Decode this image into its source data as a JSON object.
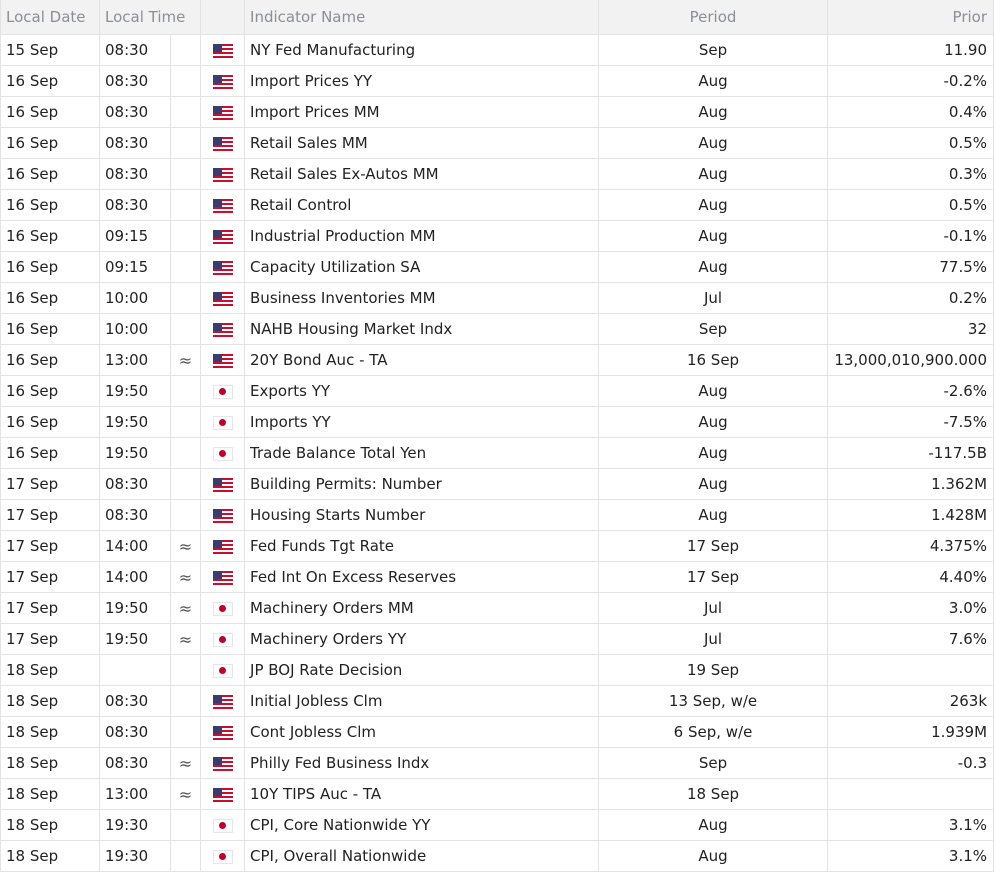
{
  "headers": {
    "date": "Local Date",
    "time": "Local Time",
    "indicator": "Indicator Name",
    "period": "Period",
    "prior": "Prior"
  },
  "flag_icons": {
    "us": "us-flag-icon",
    "jp": "japan-flag-icon"
  },
  "mark_glyph": "≈",
  "rows": [
    {
      "date": "15 Sep",
      "time": "08:30",
      "mark": "",
      "flag": "us",
      "name": "NY Fed Manufacturing",
      "period": "Sep",
      "prior": "11.90"
    },
    {
      "date": "16 Sep",
      "time": "08:30",
      "mark": "",
      "flag": "us",
      "name": "Import Prices YY",
      "period": "Aug",
      "prior": "-0.2%"
    },
    {
      "date": "16 Sep",
      "time": "08:30",
      "mark": "",
      "flag": "us",
      "name": "Import Prices MM",
      "period": "Aug",
      "prior": "0.4%"
    },
    {
      "date": "16 Sep",
      "time": "08:30",
      "mark": "",
      "flag": "us",
      "name": "Retail Sales MM",
      "period": "Aug",
      "prior": "0.5%"
    },
    {
      "date": "16 Sep",
      "time": "08:30",
      "mark": "",
      "flag": "us",
      "name": "Retail Sales Ex-Autos MM",
      "period": "Aug",
      "prior": "0.3%"
    },
    {
      "date": "16 Sep",
      "time": "08:30",
      "mark": "",
      "flag": "us",
      "name": "Retail Control",
      "period": "Aug",
      "prior": "0.5%"
    },
    {
      "date": "16 Sep",
      "time": "09:15",
      "mark": "",
      "flag": "us",
      "name": "Industrial Production MM",
      "period": "Aug",
      "prior": "-0.1%"
    },
    {
      "date": "16 Sep",
      "time": "09:15",
      "mark": "",
      "flag": "us",
      "name": "Capacity Utilization SA",
      "period": "Aug",
      "prior": "77.5%"
    },
    {
      "date": "16 Sep",
      "time": "10:00",
      "mark": "",
      "flag": "us",
      "name": "Business Inventories MM",
      "period": "Jul",
      "prior": "0.2%"
    },
    {
      "date": "16 Sep",
      "time": "10:00",
      "mark": "",
      "flag": "us",
      "name": "NAHB Housing Market Indx",
      "period": "Sep",
      "prior": "32"
    },
    {
      "date": "16 Sep",
      "time": "13:00",
      "mark": "≈",
      "flag": "us",
      "name": "20Y Bond Auc - TA",
      "period": "16 Sep",
      "prior": "13,000,010,900.000"
    },
    {
      "date": "16 Sep",
      "time": "19:50",
      "mark": "",
      "flag": "jp",
      "name": "Exports YY",
      "period": "Aug",
      "prior": "-2.6%"
    },
    {
      "date": "16 Sep",
      "time": "19:50",
      "mark": "",
      "flag": "jp",
      "name": "Imports YY",
      "period": "Aug",
      "prior": "-7.5%"
    },
    {
      "date": "16 Sep",
      "time": "19:50",
      "mark": "",
      "flag": "jp",
      "name": "Trade Balance Total Yen",
      "period": "Aug",
      "prior": "-117.5B"
    },
    {
      "date": "17 Sep",
      "time": "08:30",
      "mark": "",
      "flag": "us",
      "name": "Building Permits: Number",
      "period": "Aug",
      "prior": "1.362M"
    },
    {
      "date": "17 Sep",
      "time": "08:30",
      "mark": "",
      "flag": "us",
      "name": "Housing Starts Number",
      "period": "Aug",
      "prior": "1.428M"
    },
    {
      "date": "17 Sep",
      "time": "14:00",
      "mark": "≈",
      "flag": "us",
      "name": "Fed Funds Tgt Rate",
      "period": "17 Sep",
      "prior": "4.375%"
    },
    {
      "date": "17 Sep",
      "time": "14:00",
      "mark": "≈",
      "flag": "us",
      "name": "Fed Int On Excess Reserves",
      "period": "17 Sep",
      "prior": "4.40%"
    },
    {
      "date": "17 Sep",
      "time": "19:50",
      "mark": "≈",
      "flag": "jp",
      "name": "Machinery Orders MM",
      "period": "Jul",
      "prior": "3.0%"
    },
    {
      "date": "17 Sep",
      "time": "19:50",
      "mark": "≈",
      "flag": "jp",
      "name": "Machinery Orders YY",
      "period": "Jul",
      "prior": "7.6%"
    },
    {
      "date": "18 Sep",
      "time": "",
      "mark": "",
      "flag": "jp",
      "name": "JP BOJ Rate Decision",
      "period": "19 Sep",
      "prior": ""
    },
    {
      "date": "18 Sep",
      "time": "08:30",
      "mark": "",
      "flag": "us",
      "name": "Initial Jobless Clm",
      "period": "13 Sep, w/e",
      "prior": "263k"
    },
    {
      "date": "18 Sep",
      "time": "08:30",
      "mark": "",
      "flag": "us",
      "name": "Cont Jobless Clm",
      "period": "6 Sep, w/e",
      "prior": "1.939M"
    },
    {
      "date": "18 Sep",
      "time": "08:30",
      "mark": "≈",
      "flag": "us",
      "name": "Philly Fed Business Indx",
      "period": "Sep",
      "prior": "-0.3"
    },
    {
      "date": "18 Sep",
      "time": "13:00",
      "mark": "≈",
      "flag": "us",
      "name": "10Y TIPS Auc - TA",
      "period": "18 Sep",
      "prior": ""
    },
    {
      "date": "18 Sep",
      "time": "19:30",
      "mark": "",
      "flag": "jp",
      "name": "CPI, Core Nationwide YY",
      "period": "Aug",
      "prior": "3.1%"
    },
    {
      "date": "18 Sep",
      "time": "19:30",
      "mark": "",
      "flag": "jp",
      "name": "CPI, Overall Nationwide",
      "period": "Aug",
      "prior": "3.1%"
    }
  ]
}
